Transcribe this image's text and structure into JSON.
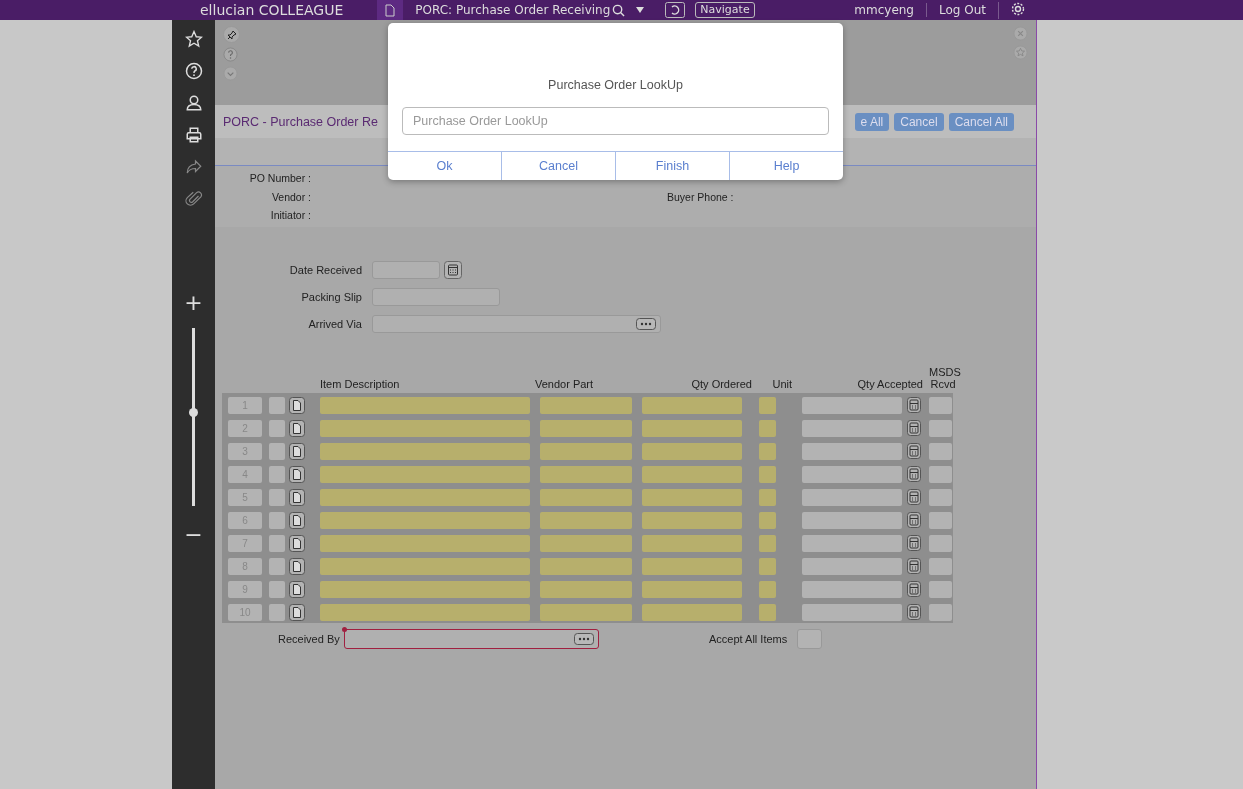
{
  "topbar": {
    "logo": "ellucian COLLEAGUE",
    "form_title": "PORC: Purchase Order Receiving",
    "navigate": "Navigate",
    "user": "mmcyeng",
    "logout": "Log Out"
  },
  "sidebar": {
    "zoom_in": "+",
    "zoom_out": "−",
    "zoom": {
      "level": 0.52
    }
  },
  "form": {
    "title": "PORC - Purchase Order Re",
    "buttons": [
      "e All",
      "Cancel",
      "Cancel All"
    ],
    "info_labels": [
      "PO Number :",
      "Vendor :",
      "Initiator :"
    ],
    "buyer_phone_label": "Buyer Phone :",
    "fields": [
      {
        "label": "Date Received",
        "kind": "date"
      },
      {
        "label": "Packing Slip",
        "kind": "text"
      },
      {
        "label": "Arrived Via",
        "kind": "lookup"
      }
    ],
    "columns": [
      "Item Description",
      "Vendor Part",
      "Qty Ordered",
      "Unit",
      "Qty Accepted",
      "MSDS Rcvd"
    ],
    "rows": [
      {
        "number": "1",
        "msds_rcvd": false
      },
      {
        "number": "2",
        "msds_rcvd": false
      },
      {
        "number": "3",
        "msds_rcvd": false
      },
      {
        "number": "4",
        "msds_rcvd": false
      },
      {
        "number": "5",
        "msds_rcvd": false
      },
      {
        "number": "6",
        "msds_rcvd": false
      },
      {
        "number": "7",
        "msds_rcvd": false
      },
      {
        "number": "8",
        "msds_rcvd": false
      },
      {
        "number": "9",
        "msds_rcvd": false
      },
      {
        "number": "10",
        "msds_rcvd": false
      }
    ],
    "received_by": {
      "label": "Received By",
      "required": true
    },
    "accept_all": {
      "label": "Accept All Items",
      "checked": false
    }
  },
  "dialog": {
    "title": "Purchase Order LookUp",
    "placeholder": "Purchase Order LookUp",
    "buttons": [
      "Ok",
      "Cancel",
      "Finish",
      "Help"
    ]
  }
}
